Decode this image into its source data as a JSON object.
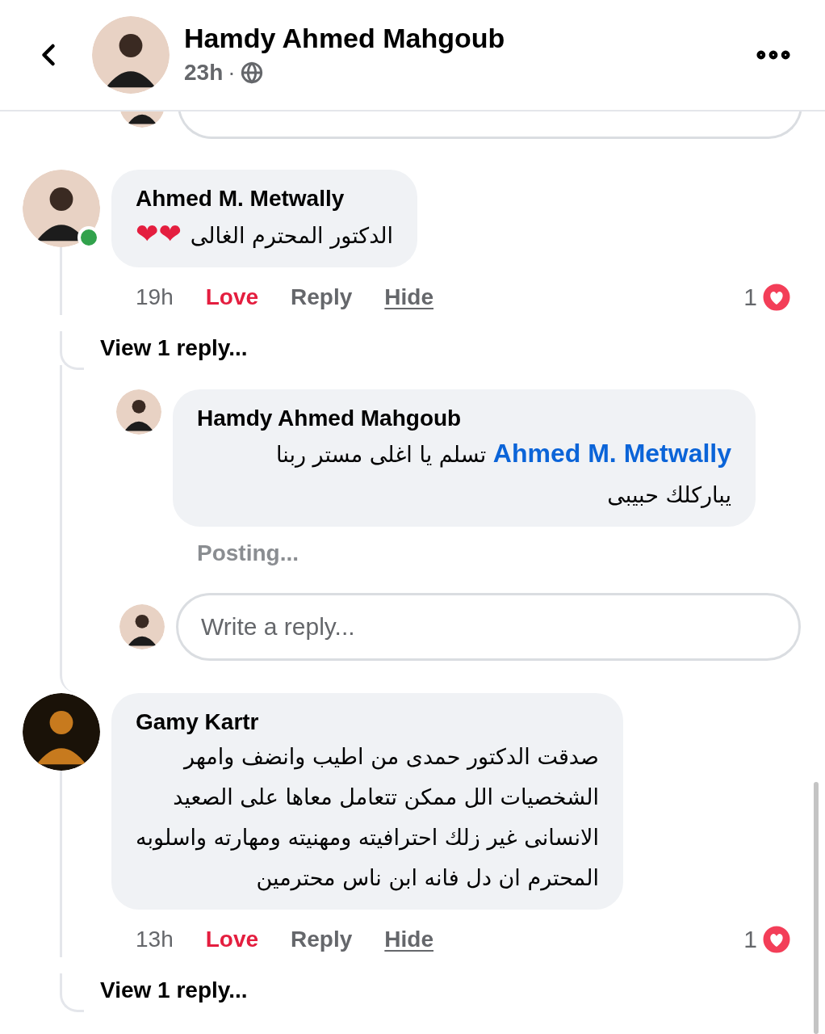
{
  "header": {
    "author": "Hamdy Ahmed Mahgoub",
    "time": "23h",
    "separator": "·"
  },
  "comments": [
    {
      "author": "Ahmed M. Metwally",
      "online": true,
      "text": "الدكتور المحترم الغالى",
      "emoji": "❤❤",
      "time": "19h",
      "reaction": {
        "label": "Love",
        "active": true
      },
      "actions": [
        "Reply",
        "Hide"
      ],
      "reaction_count": "1",
      "view_replies": "View 1 reply...",
      "replies": [
        {
          "author": "Hamdy Ahmed Mahgoub",
          "mention": "Ahmed M. Metwally",
          "text": "تسلم يا اغلى مستر ربنا\nيباركلك حبيبى",
          "status": "Posting..."
        }
      ],
      "reply_field": {
        "placeholder": "Write a reply..."
      }
    },
    {
      "author": "Gamy Kartr",
      "online": false,
      "text": "صدقت الدكتور حمدى من اطيب وانضف وامهر\nالشخصيات  الل ممكن تتعامل معاها على الصعيد\nالانسانى غير زلك احترافيته ومهنيته ومهارته   واسلوبه\nالمحترم ان دل فانه ابن ناس محترمين",
      "time": "13h",
      "reaction": {
        "label": "Love",
        "active": true
      },
      "actions": [
        "Reply",
        "Hide"
      ],
      "reaction_count": "1",
      "view_replies": "View 1 reply..."
    }
  ]
}
